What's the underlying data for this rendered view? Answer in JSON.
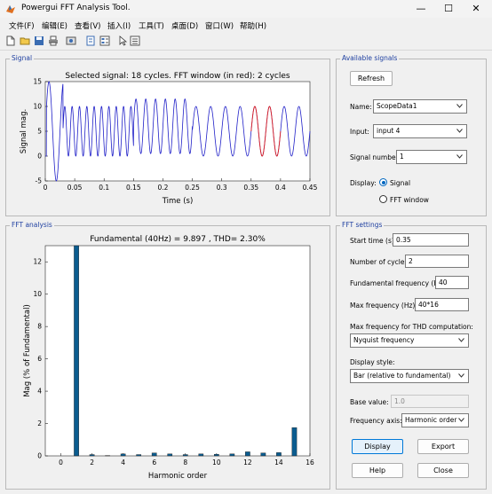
{
  "window": {
    "title": "Powergui FFT Analysis Tool.",
    "controls": [
      "—",
      "☐",
      "✕"
    ]
  },
  "menu": [
    "文件(F)",
    "编辑(E)",
    "查看(V)",
    "插入(I)",
    "工具(T)",
    "桌面(D)",
    "窗口(W)",
    "帮助(H)"
  ],
  "signal_panel": {
    "title": "Signal"
  },
  "available_panel": {
    "title": "Available signals",
    "refresh": "Refresh",
    "name_label": "Name:",
    "name_value": "ScopeData1",
    "input_label": "Input:",
    "input_value": "input 4",
    "number_label": "Signal number:",
    "number_value": "1",
    "display_label": "Display:",
    "display_options": [
      "Signal",
      "FFT window"
    ],
    "display_selected": "Signal"
  },
  "fft_panel": {
    "title": "FFT analysis"
  },
  "settings_panel": {
    "title": "FFT settings",
    "start_label": "Start time (s):",
    "start_value": "0.35",
    "cycles_label": "Number of cycles:",
    "cycles_value": "2",
    "fund_label": "Fundamental frequency (Hz):",
    "fund_value": "40",
    "maxf_label": "Max frequency (Hz):",
    "maxf_value": "40*16",
    "thd_label": "Max frequency for THD computation:",
    "thd_value": "Nyquist frequency",
    "style_label": "Display style:",
    "style_value": "Bar (relative to fundamental)",
    "base_label": "Base value:",
    "base_value": "1.0",
    "axis_label": "Frequency axis:",
    "axis_value": "Harmonic order",
    "buttons": {
      "display": "Display",
      "export": "Export",
      "help": "Help",
      "close": "Close"
    }
  },
  "chart_data": [
    {
      "type": "line",
      "title": "Selected signal: 18 cycles. FFT window (in red): 2 cycles",
      "xlabel": "Time (s)",
      "ylabel": "Signal mag.",
      "xlim": [
        0,
        0.45
      ],
      "ylim": [
        -5,
        15
      ],
      "xticks": [
        "0",
        "0.05",
        "0.1",
        "0.15",
        "0.2",
        "0.25",
        "0.3",
        "0.35",
        "0.4",
        "0.45"
      ],
      "yticks": [
        "-5",
        "0",
        "5",
        "10",
        "15"
      ],
      "series": [
        {
          "color": "#2020c8",
          "segments": [
            {
              "t0": 0,
              "t1": 0.03,
              "freq": 40,
              "center": 5,
              "amp": 10
            },
            {
              "t0": 0.03,
              "t1": 0.15,
              "freq": 80,
              "center": 5,
              "amp": 5
            },
            {
              "t0": 0.15,
              "t1": 0.25,
              "freq": 60,
              "center": 6,
              "amp": 5.5
            },
            {
              "t0": 0.25,
              "t1": 0.45,
              "freq": 40,
              "center": 5,
              "amp": 5
            }
          ]
        },
        {
          "color": "#e02020",
          "window": [
            0.35,
            0.4
          ]
        }
      ],
      "grid": false
    },
    {
      "type": "bar",
      "title": "Fundamental (40Hz) = 9.897 , THD= 2.30%",
      "xlabel": "Harmonic order",
      "ylabel": "Mag (% of Fundamental)",
      "xlim": [
        -1,
        16
      ],
      "ylim": [
        0,
        13
      ],
      "xticks": [
        "0",
        "2",
        "4",
        "6",
        "8",
        "10",
        "12",
        "14",
        "16"
      ],
      "yticks": [
        "0",
        "2",
        "4",
        "6",
        "8",
        "10",
        "12"
      ],
      "x": [
        0,
        1,
        2,
        3,
        4,
        5,
        6,
        7,
        8,
        9,
        10,
        11,
        12,
        13,
        14,
        15
      ],
      "values": [
        0,
        100,
        0.08,
        0.02,
        0.12,
        0.08,
        0.18,
        0.12,
        0.08,
        0.12,
        0.1,
        0.12,
        0.25,
        0.18,
        0.2,
        1.75
      ],
      "bar_color": "#0b5c8f",
      "grid": false
    }
  ]
}
